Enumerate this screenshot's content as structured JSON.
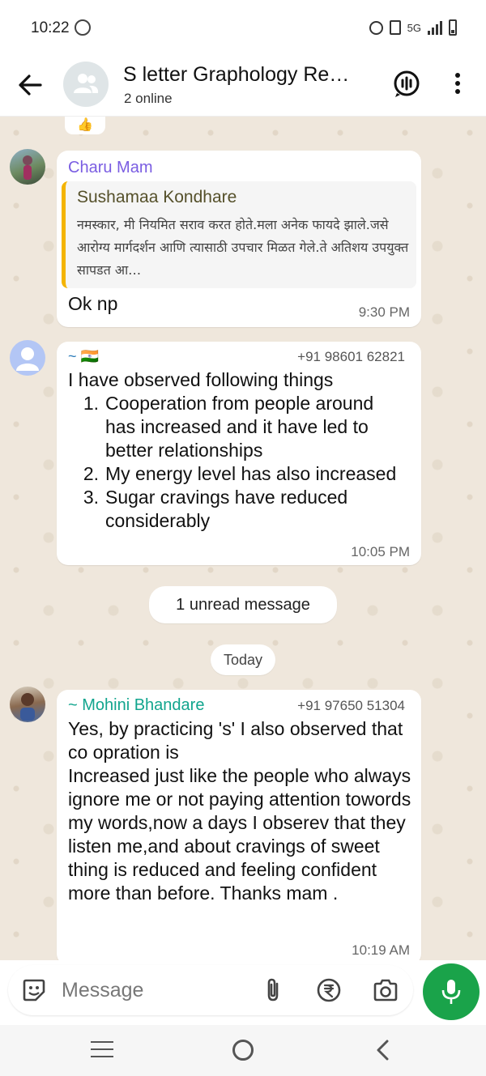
{
  "status_bar": {
    "time": "10:22",
    "network_label": "5G",
    "colors": {
      "text": "#222222"
    }
  },
  "header": {
    "title": "S letter Graphology Re…",
    "subtitle": "2 online",
    "icons": [
      "back-arrow-icon",
      "group-avatar-icon",
      "voice-call-icon",
      "more-options-icon"
    ]
  },
  "messages": [
    {
      "sender": "Charu Mam",
      "sender_color": "#7a5de2",
      "quoted": {
        "author": "Sushamaa Kondhare",
        "text": "नमस्कार, मी नियमित सराव करत होते.मला अनेक फायदे झाले.जसे आरोग्य मार्गदर्शन आणि त्यासाठी उपचार मिळत गेले.ते अतिशय उपयुक्त सापडत आ…"
      },
      "text": "Ok np",
      "time": "9:30 PM"
    },
    {
      "sender": "~ 🇮🇳",
      "phone": "+91 98601 62821",
      "intro": "I have observed following things",
      "list": [
        {
          "num": "1.",
          "text": "Cooperation from people around has increased and it have led to better relationships"
        },
        {
          "num": "2.",
          "text": "My energy level has also increased"
        },
        {
          "num": "3.",
          "text": "Sugar cravings have reduced considerably"
        }
      ],
      "time": "10:05 PM"
    },
    {
      "sender": "~ Mohini Bhandare",
      "sender_color": "#12a58e",
      "phone": "+91 97650 51304",
      "text": "Yes, by practicing 's' I also observed that co opration is\nIncreased  just like the people who always ignore me or not paying attention towords my words,now a days I obserev that they listen me,and about cravings of sweet thing is reduced and feeling confident more than before. Thanks mam .",
      "time": "10:19 AM"
    }
  ],
  "unread_label": "1 unread message",
  "date_label": "Today",
  "composer": {
    "placeholder": "Message",
    "accent": "#1aa34a"
  }
}
